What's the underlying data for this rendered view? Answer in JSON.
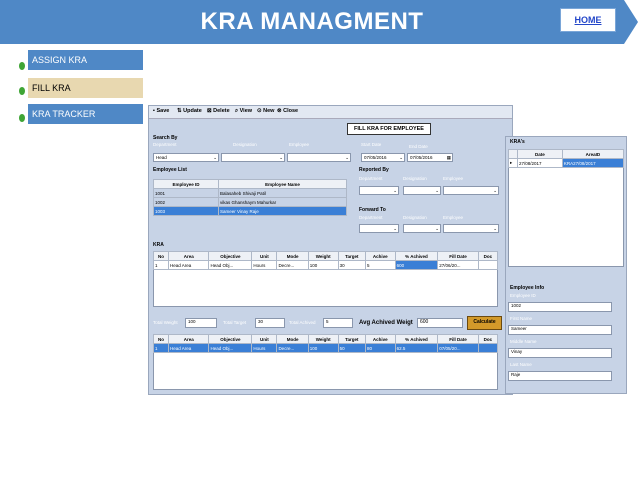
{
  "page": {
    "title": "KRA MANAGMENT",
    "home_label": "HOME"
  },
  "menu": [
    {
      "label": "ASSIGN KRA"
    },
    {
      "label": "FILL KRA"
    },
    {
      "label": "KRA TRACKER"
    }
  ],
  "toolbar": {
    "save": "Save",
    "update": "Update",
    "delete": "Delete",
    "view": "View",
    "new": "New",
    "close": "Close"
  },
  "form": {
    "title": "FILL KRA FOR EMPLOYEE",
    "search_by": "Search By",
    "department_label": "Department",
    "designation_label": "Designation",
    "employee_label": "Employee",
    "department_value": "Head",
    "start_date_label": "Start Date",
    "start_date": "07/05/2016",
    "end_date_label": "End Date",
    "end_date": "07/05/2016",
    "employee_list_label": "Employee List",
    "employee_list": {
      "columns": [
        "Employee ID",
        "Employee Name"
      ],
      "rows": [
        [
          "1001",
          "Balasaheb  Shivaji Patil"
        ],
        [
          "1002",
          "vikas Ghanshaym Mahurkar"
        ],
        [
          "1003",
          "Sameer Vinay Raje"
        ]
      ]
    },
    "reported_by": "Reported By",
    "forward_to": "Forward To",
    "kra_label": "KRA",
    "kra_columns": [
      "No",
      "Area",
      "Objective",
      "Unit",
      "Mode",
      "Weight",
      "Target",
      "Achive",
      "% Achived",
      "Fill Date",
      "Doc"
    ],
    "kra_row": [
      "1",
      "Head Area",
      "Head Obj...",
      "Hours",
      "Decre...",
      "100",
      "30",
      "5",
      "600",
      "27/06/20...",
      ""
    ],
    "total_weight_label": "Total Weight",
    "total_weight": "100",
    "total_target_label": "Total Target",
    "total_target": "30",
    "total_achived_label": "Total Achived",
    "total_achived": "5",
    "avg_label": "Avg Achived Weigt",
    "avg_value": "600",
    "calculate_label": "Calculate",
    "kra2_row": [
      "1",
      "Head Area",
      "Head Obj...",
      "Hours",
      "Decre...",
      "100",
      "50",
      "80",
      "62.5",
      "07/05/20...",
      ""
    ]
  },
  "kras": {
    "label": "KRA's",
    "columns": [
      "Date",
      "AreaID"
    ],
    "rows": [
      [
        "27/08/2017",
        "KRA27/08/2017"
      ]
    ]
  },
  "employee_info": {
    "label": "Employee Info",
    "employee_id_label": "Employee ID",
    "employee_id": "1002",
    "first_name_label": "First Name",
    "first_name": "Sameer",
    "middle_name_label": "Middle Name",
    "middle_name": "Vinay",
    "last_name_label": "Last Name",
    "last_name": "Raje"
  }
}
